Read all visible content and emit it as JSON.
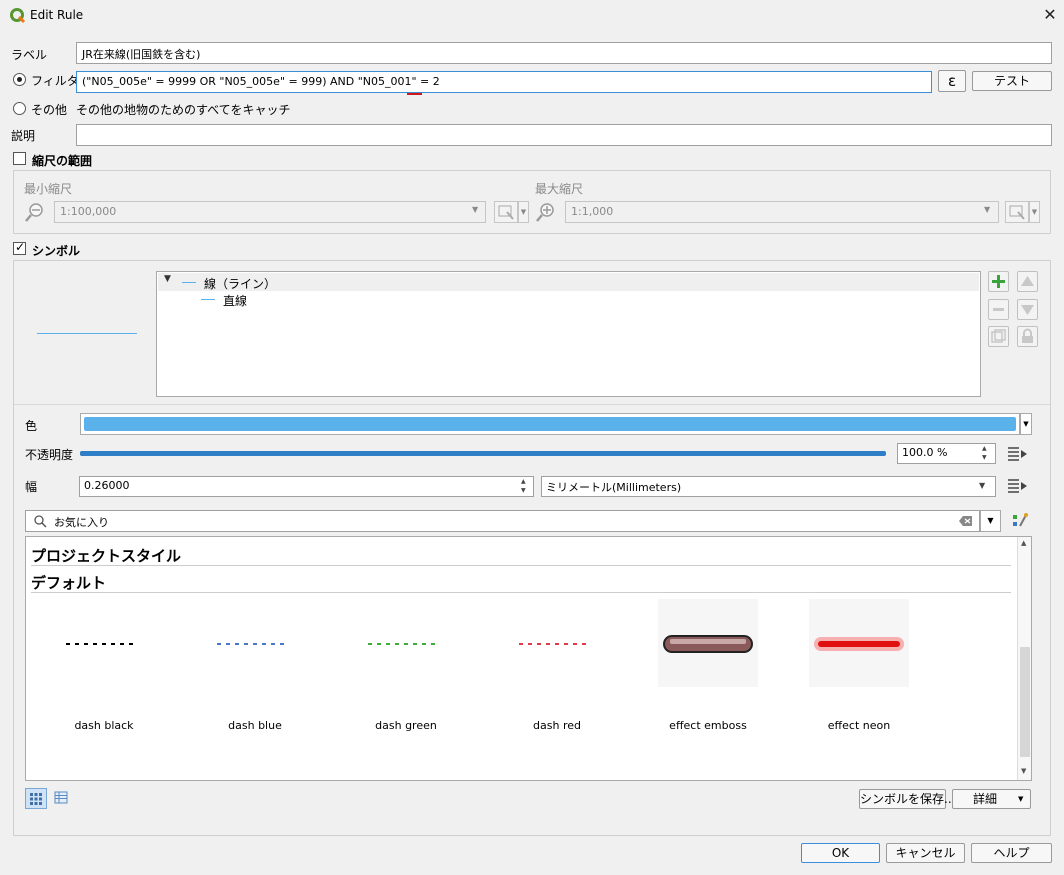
{
  "window": {
    "title": "Edit Rule",
    "close_glyph": "✕"
  },
  "label_row": {
    "label": "ラベル",
    "value": "JR在来線(旧国鉄を含む)"
  },
  "filter_row": {
    "label": "フィルタ",
    "value": "(\"N05_005e\"  = 9999   OR \"N05_005e\"  = 999) AND \"N05_001\" = 2",
    "expr_glyph": "ε",
    "test_label": "テスト"
  },
  "else_row": {
    "label": "その他",
    "desc": "その他の地物のためのすべてをキャッチ"
  },
  "description_row": {
    "label": "説明",
    "value": ""
  },
  "scale": {
    "label": "縮尺の範囲",
    "min_label": "最小縮尺",
    "min_value": "1:100,000",
    "max_label": "最大縮尺",
    "max_value": "1:1,000"
  },
  "symbol": {
    "label": "シンボル",
    "tree_parent": "線（ライン）",
    "tree_child": "直線"
  },
  "props": {
    "color_label": "色",
    "color": "#5bb2ea",
    "opacity_label": "不透明度",
    "opacity_value": "100.0 %",
    "opacity": 1.0,
    "width_label": "幅",
    "width_value": "0.26000",
    "unit_value": "ミリメートル(Millimeters)"
  },
  "library": {
    "search_value": "お気に入り",
    "section1": "プロジェクトスタイル",
    "section2": "デフォルト",
    "symbols": [
      {
        "name": "dash  black",
        "color": "#000000",
        "style": "dash"
      },
      {
        "name": "dash blue",
        "color": "#4a78c8",
        "style": "dash"
      },
      {
        "name": "dash green",
        "color": "#3cae3c",
        "style": "dash"
      },
      {
        "name": "dash red",
        "color": "#e23a4a",
        "style": "dash"
      },
      {
        "name": "effect emboss",
        "color": "#8a5a5a",
        "style": "emboss"
      },
      {
        "name": "effect neon",
        "color": "#e01010",
        "style": "neon"
      }
    ],
    "save_label": "シンボルを保存...",
    "detail_label": "詳細"
  },
  "footer": {
    "ok": "OK",
    "cancel": "キャンセル",
    "help": "ヘルプ"
  }
}
